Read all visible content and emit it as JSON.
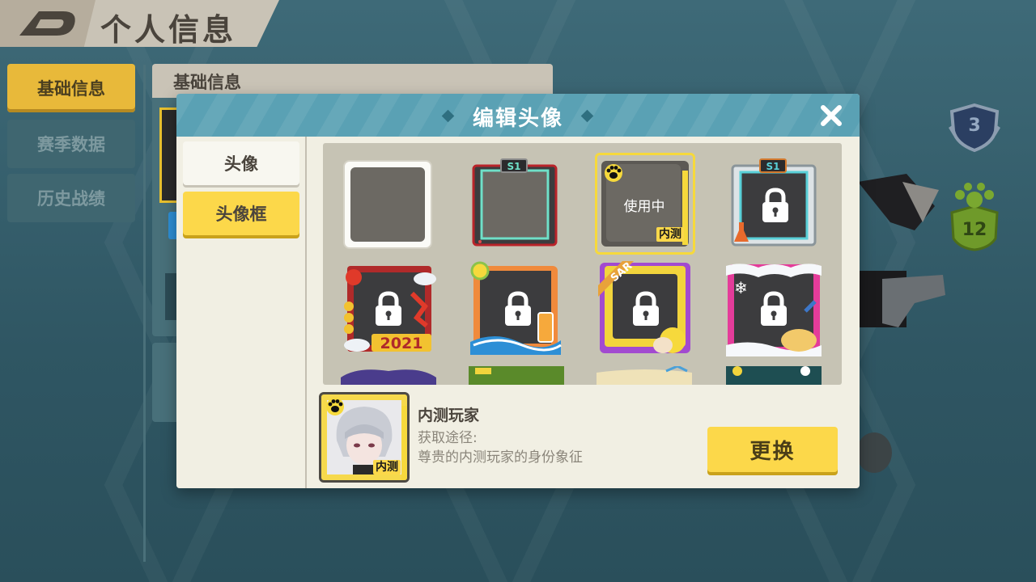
{
  "header": {
    "title": "个人信息"
  },
  "nav": {
    "items": [
      {
        "label": "基础信息",
        "active": true
      },
      {
        "label": "赛季数据",
        "active": false
      },
      {
        "label": "历史战绩",
        "active": false
      }
    ]
  },
  "background_panel": {
    "title": "基础信息"
  },
  "badges": {
    "rank_number": "3",
    "paw_number": "12"
  },
  "modal": {
    "title": "编辑头像",
    "tabs": [
      {
        "label": "头像",
        "active": false
      },
      {
        "label": "头像框",
        "active": true
      }
    ],
    "frames": [
      {
        "kind": "plain",
        "locked": false
      },
      {
        "kind": "s1-red",
        "locked": false,
        "badge": "S1"
      },
      {
        "kind": "neice",
        "locked": false,
        "status": "使用中",
        "tag": "内测",
        "selected": true
      },
      {
        "kind": "s1-lab",
        "locked": true,
        "badge": "S1"
      },
      {
        "kind": "2021",
        "locked": true,
        "badge": "2021"
      },
      {
        "kind": "summer",
        "locked": true
      },
      {
        "kind": "sar",
        "locked": true,
        "badge": "SAR"
      },
      {
        "kind": "snow",
        "locked": true
      }
    ],
    "preview": {
      "tag": "内测",
      "name": "内测玩家",
      "source_label": "获取途径:",
      "description": "尊贵的内测玩家的身份象征"
    },
    "replace_button": "更换"
  },
  "colors": {
    "accent_yellow": "#fcd84a",
    "modal_header": "#5aa1b4",
    "nav_active": "#e8b93a",
    "panel": "#f1efe3"
  }
}
